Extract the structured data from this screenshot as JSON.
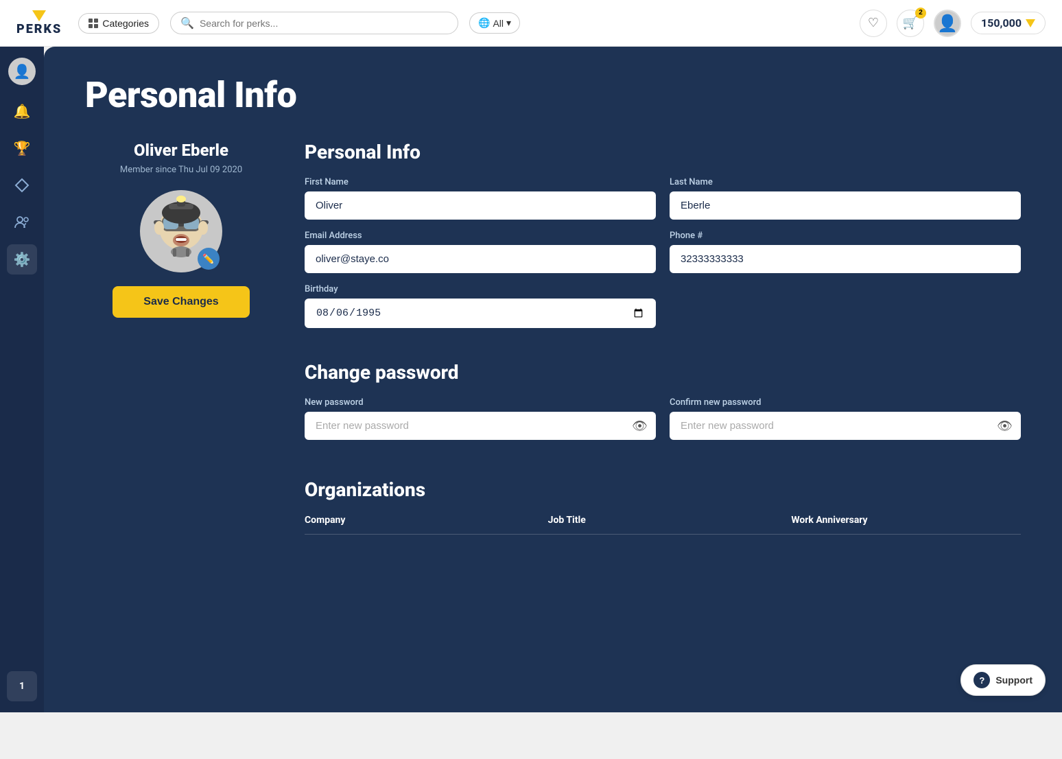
{
  "app": {
    "name": "PERKS"
  },
  "topnav": {
    "categories_label": "Categories",
    "search_placeholder": "Search for perks...",
    "region_label": "All",
    "points": "150,000",
    "cart_badge": "2"
  },
  "sidebar": {
    "items": [
      {
        "name": "profile",
        "icon": "👤"
      },
      {
        "name": "notifications",
        "icon": "🔔"
      },
      {
        "name": "rewards",
        "icon": "🏆"
      },
      {
        "name": "points",
        "icon": "◇"
      },
      {
        "name": "users",
        "icon": "👥"
      },
      {
        "name": "settings",
        "icon": "⚙️"
      }
    ],
    "bottom_item": {
      "name": "help",
      "icon": "❓"
    }
  },
  "page": {
    "title": "Personal Info"
  },
  "profile": {
    "name": "Oliver Eberle",
    "member_since": "Member since Thu Jul 09 2020",
    "save_changes_label": "Save Changes"
  },
  "personal_info": {
    "section_title": "Personal Info",
    "first_name_label": "First Name",
    "first_name_value": "Oliver",
    "last_name_label": "Last Name",
    "last_name_value": "Eberle",
    "email_label": "Email Address",
    "email_value": "oliver@staye.co",
    "phone_label": "Phone #",
    "phone_value": "32333333333",
    "birthday_label": "Birthday",
    "birthday_value": "08/06/1995"
  },
  "change_password": {
    "section_title": "Change password",
    "new_password_label": "New password",
    "new_password_placeholder": "Enter new password",
    "confirm_password_label": "Confirm new password",
    "confirm_password_placeholder": "Enter new password"
  },
  "organizations": {
    "section_title": "Organizations",
    "columns": [
      "Company",
      "Job Title",
      "Work Anniversary"
    ]
  },
  "support": {
    "label": "Support"
  }
}
